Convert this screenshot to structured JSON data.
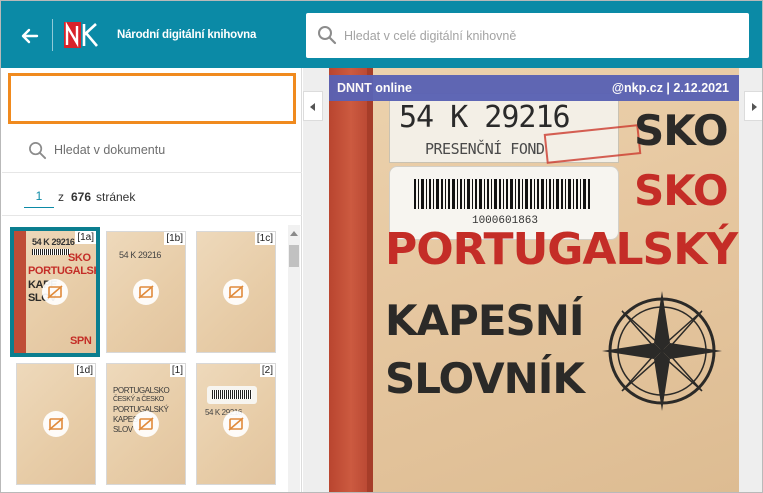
{
  "header": {
    "back_icon": "arrow-left-icon",
    "logo_text": "NK",
    "site_name": "Národní digitální knihovna",
    "search_placeholder": "Hledat v celé digitální knihovně",
    "colors": {
      "bar": "#0b8aa6",
      "logo_red": "#d8232a"
    }
  },
  "left_panel": {
    "title_value": "",
    "search_placeholder": "Hledat v dokumentu",
    "pager": {
      "current": "1",
      "of_label": "z",
      "total": "676",
      "unit": "stránek"
    },
    "thumbnails": [
      {
        "tag": "[1a]",
        "selected": true,
        "line1": "54 K 29216",
        "line2": "SKO",
        "line3": "PORTUGALSKÝ",
        "line4": "KAPE",
        "line5": "SLOV",
        "line6": "SPN"
      },
      {
        "tag": "[1b]",
        "selected": false,
        "line1": "54 K 29216"
      },
      {
        "tag": "[1c]",
        "selected": false
      },
      {
        "tag": "[1d]",
        "selected": false
      },
      {
        "tag": "[1]",
        "selected": false,
        "line1": "PORTUGALSKO",
        "line2": "ČESKÝ a ČESKO",
        "line3": "PORTUGALSKÝ",
        "line4": "KAPES",
        "line5": "SLOV"
      },
      {
        "tag": "[2]",
        "selected": false,
        "line1": "54 K 29216"
      }
    ],
    "lock_icon": "hidden-image-icon",
    "accent": "#f08a1e",
    "selected_border": "#0b7e8f"
  },
  "viewer": {
    "overlay_left": "DNNT online",
    "overlay_right": "@nkp.cz | 2.12.2021",
    "collapse_left_icon": "chevron-left-icon",
    "collapse_right_icon": "chevron-right-icon",
    "cover": {
      "shelf_mark": "54 K 29216",
      "fond": "PRESENČNÍ FOND",
      "barcode": "1000601863",
      "line_sko1": "SKO",
      "line_sko2": "SKO",
      "line_portugalsky": "PORTUGALSKÝ",
      "line_kapesni": "KAPESNÍ",
      "line_slovnik": "SLOVNÍK"
    },
    "overlay_color": "#5a62b4"
  }
}
